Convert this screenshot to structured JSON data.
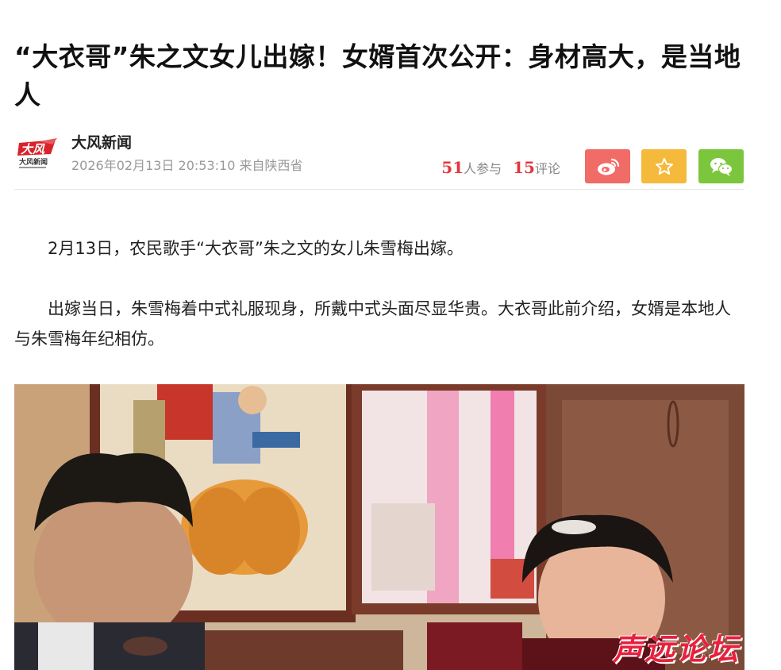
{
  "article": {
    "title": "“大衣哥”朱之文女儿出嫁！女婿首次公开：身材高大，是当地人"
  },
  "meta": {
    "source_name": "大风新闻",
    "logo_text": "大风",
    "logo_subtext": "大风新闻",
    "published": "2026年02月13日 20:53:10 来自陕西省",
    "participants_count": "51",
    "participants_label": "人参与",
    "comments_count": "15",
    "comments_label": "评论"
  },
  "share": {
    "weibo_icon": "weibo-icon",
    "favorite_icon": "star-icon",
    "wechat_icon": "wechat-icon",
    "colors": {
      "weibo": "#f16b67",
      "favorite": "#f5b93b",
      "wechat": "#7cc63d"
    }
  },
  "body": {
    "paragraphs": [
      "2月13日，农民歌手“大衣哥”朱之文的女儿朱雪梅出嫁。",
      "出嫁当日，朱雪梅着中式礼服现身，所戴中式头面尽显华贵。大衣哥此前介绍，女婿是本地人与朱雪梅年纪相仿。"
    ]
  },
  "watermark": {
    "text": "声远论坛"
  },
  "accent_color": "#e0383e"
}
